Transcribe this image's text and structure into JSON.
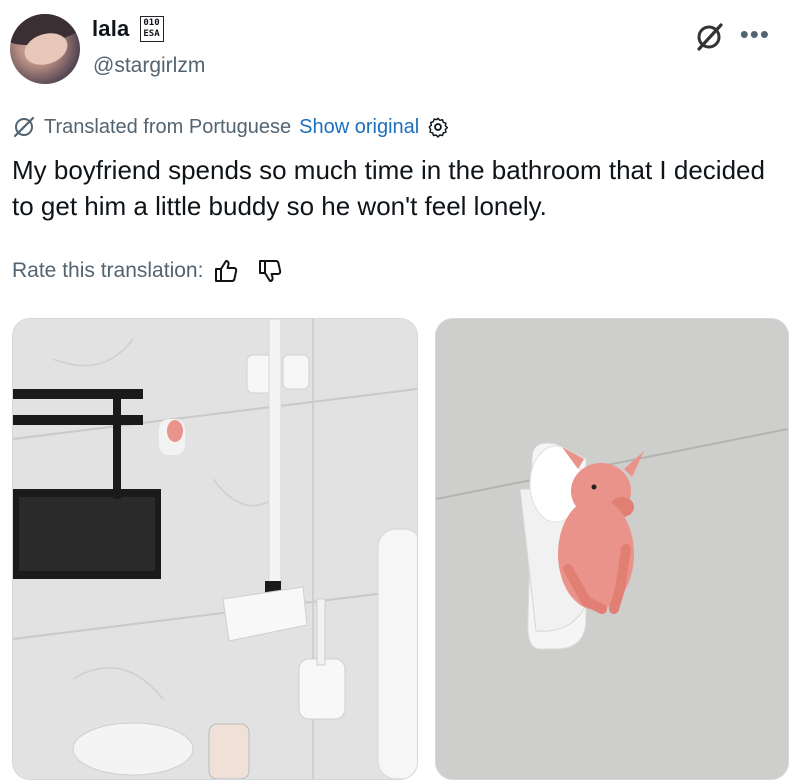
{
  "author": {
    "display_name": "lala",
    "badge_text": "010\nESA",
    "handle": "@stargirlzm"
  },
  "header_icons": {
    "brand": "x-logo-icon",
    "more": "more-icon",
    "more_label": "•••"
  },
  "translation": {
    "translated_from": "Translated from Portuguese",
    "show_original": "Show original",
    "settings_icon": "gear-icon"
  },
  "post": {
    "text": "My boyfriend spends so much time in the bathroom that I decided to get him a little buddy so he won't feel lonely."
  },
  "rating": {
    "label": "Rate this translation:",
    "thumbs_up_icon": "thumbs-up-icon",
    "thumbs_down_icon": "thumbs-down-icon"
  },
  "media": {
    "items": [
      {
        "name": "bathroom-photo"
      },
      {
        "name": "pig-toilet-closeup-photo"
      }
    ]
  },
  "colors": {
    "link_blue": "#1d6fbf",
    "secondary_text": "#536471",
    "primary_text": "#0f1419",
    "pig_pink": "#e9938a"
  }
}
